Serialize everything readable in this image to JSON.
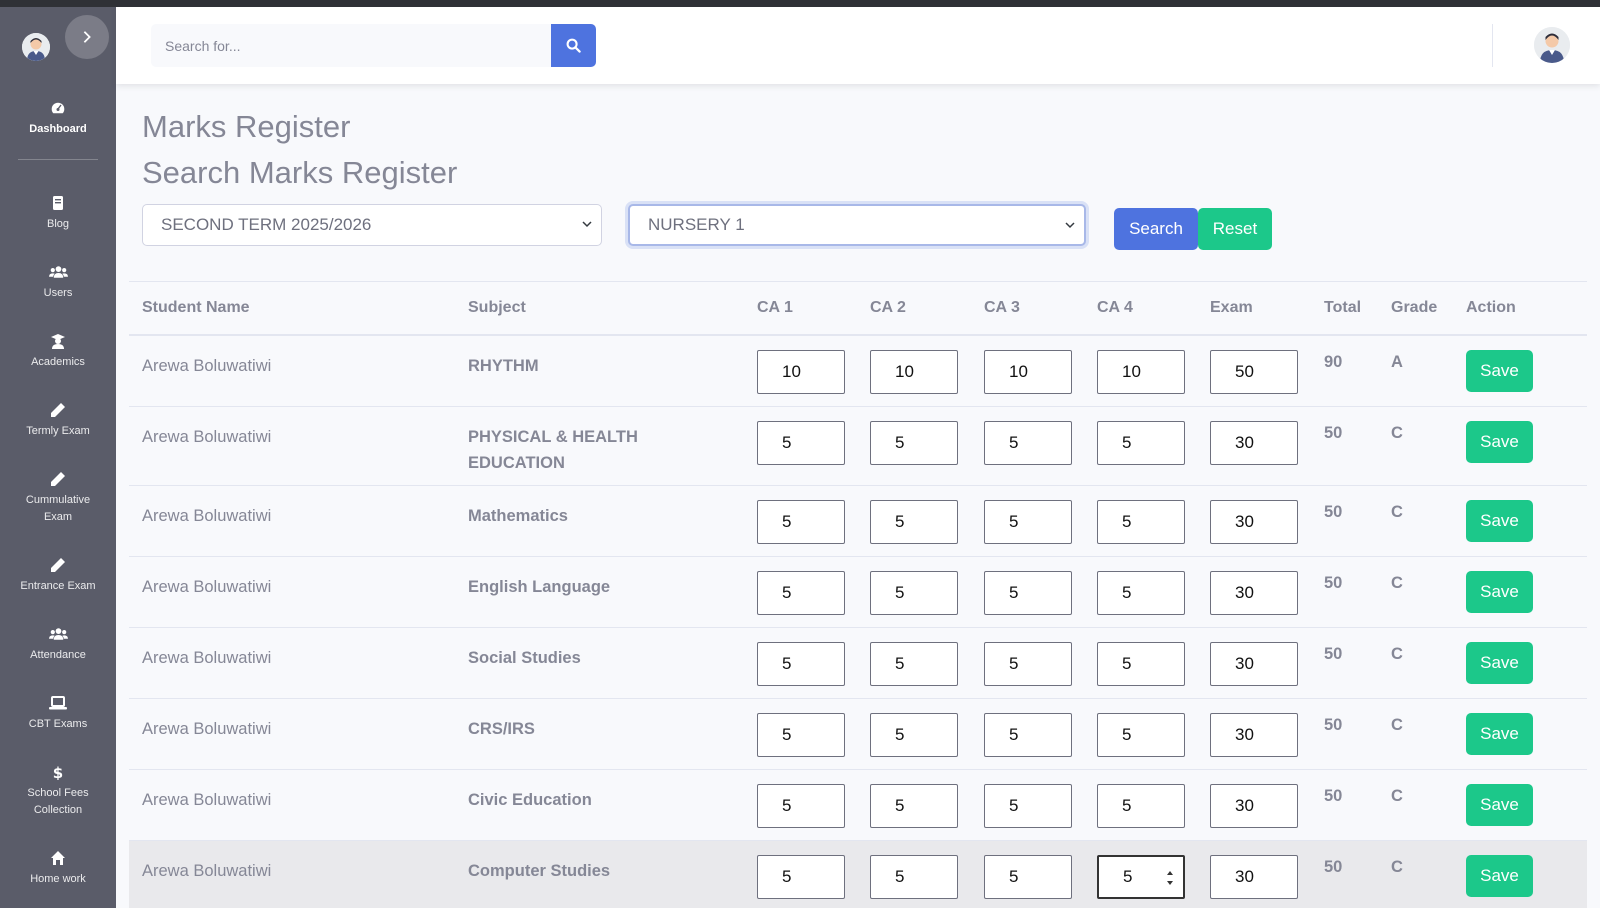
{
  "sidebar": {
    "items": [
      {
        "label": "Dashboard",
        "icon": "tachometer-icon",
        "active": true
      },
      {
        "label": "Blog",
        "icon": "book-icon"
      },
      {
        "label": "Users",
        "icon": "users-icon"
      },
      {
        "label": "Academics",
        "icon": "graduate-icon"
      },
      {
        "label": "Termly Exam",
        "icon": "pencil-icon"
      },
      {
        "label": "Cummulative Exam",
        "icon": "pencil-icon"
      },
      {
        "label": "Entrance Exam",
        "icon": "pencil-icon"
      },
      {
        "label": "Attendance",
        "icon": "users-icon"
      },
      {
        "label": "CBT Exams",
        "icon": "laptop-icon"
      },
      {
        "label": "School Fees Collection",
        "icon": "dollar-icon"
      },
      {
        "label": "Home work",
        "icon": "home-icon"
      }
    ]
  },
  "topbar": {
    "search_placeholder": "Search for..."
  },
  "page": {
    "title": "Marks Register",
    "subtitle": "Search Marks Register"
  },
  "filters": {
    "term": "SECOND TERM 2025/2026",
    "class": "NURSERY 1",
    "search_label": "Search",
    "reset_label": "Reset"
  },
  "table": {
    "headers": [
      "Student Name",
      "Subject",
      "CA 1",
      "CA 2",
      "CA 3",
      "CA 4",
      "Exam",
      "Total",
      "Grade",
      "Action"
    ],
    "save_label": "Save",
    "rows": [
      {
        "student": "Arewa Boluwatiwi",
        "subject": "RHYTHM",
        "ca1": "10",
        "ca2": "10",
        "ca3": "10",
        "ca4": "10",
        "exam": "50",
        "total": "90",
        "grade": "A"
      },
      {
        "student": "Arewa Boluwatiwi",
        "subject": "PHYSICAL & HEALTH EDUCATION",
        "ca1": "5",
        "ca2": "5",
        "ca3": "5",
        "ca4": "5",
        "exam": "30",
        "total": "50",
        "grade": "C"
      },
      {
        "student": "Arewa Boluwatiwi",
        "subject": "Mathematics",
        "ca1": "5",
        "ca2": "5",
        "ca3": "5",
        "ca4": "5",
        "exam": "30",
        "total": "50",
        "grade": "C"
      },
      {
        "student": "Arewa Boluwatiwi",
        "subject": "English Language",
        "ca1": "5",
        "ca2": "5",
        "ca3": "5",
        "ca4": "5",
        "exam": "30",
        "total": "50",
        "grade": "C"
      },
      {
        "student": "Arewa Boluwatiwi",
        "subject": "Social Studies",
        "ca1": "5",
        "ca2": "5",
        "ca3": "5",
        "ca4": "5",
        "exam": "30",
        "total": "50",
        "grade": "C"
      },
      {
        "student": "Arewa Boluwatiwi",
        "subject": "CRS/IRS",
        "ca1": "5",
        "ca2": "5",
        "ca3": "5",
        "ca4": "5",
        "exam": "30",
        "total": "50",
        "grade": "C"
      },
      {
        "student": "Arewa Boluwatiwi",
        "subject": "Civic Education",
        "ca1": "5",
        "ca2": "5",
        "ca3": "5",
        "ca4": "5",
        "exam": "30",
        "total": "50",
        "grade": "C"
      },
      {
        "student": "Arewa Boluwatiwi",
        "subject": "Computer Studies",
        "ca1": "5",
        "ca2": "5",
        "ca3": "5",
        "ca4": "5",
        "exam": "30",
        "total": "50",
        "grade": "C"
      }
    ]
  }
}
